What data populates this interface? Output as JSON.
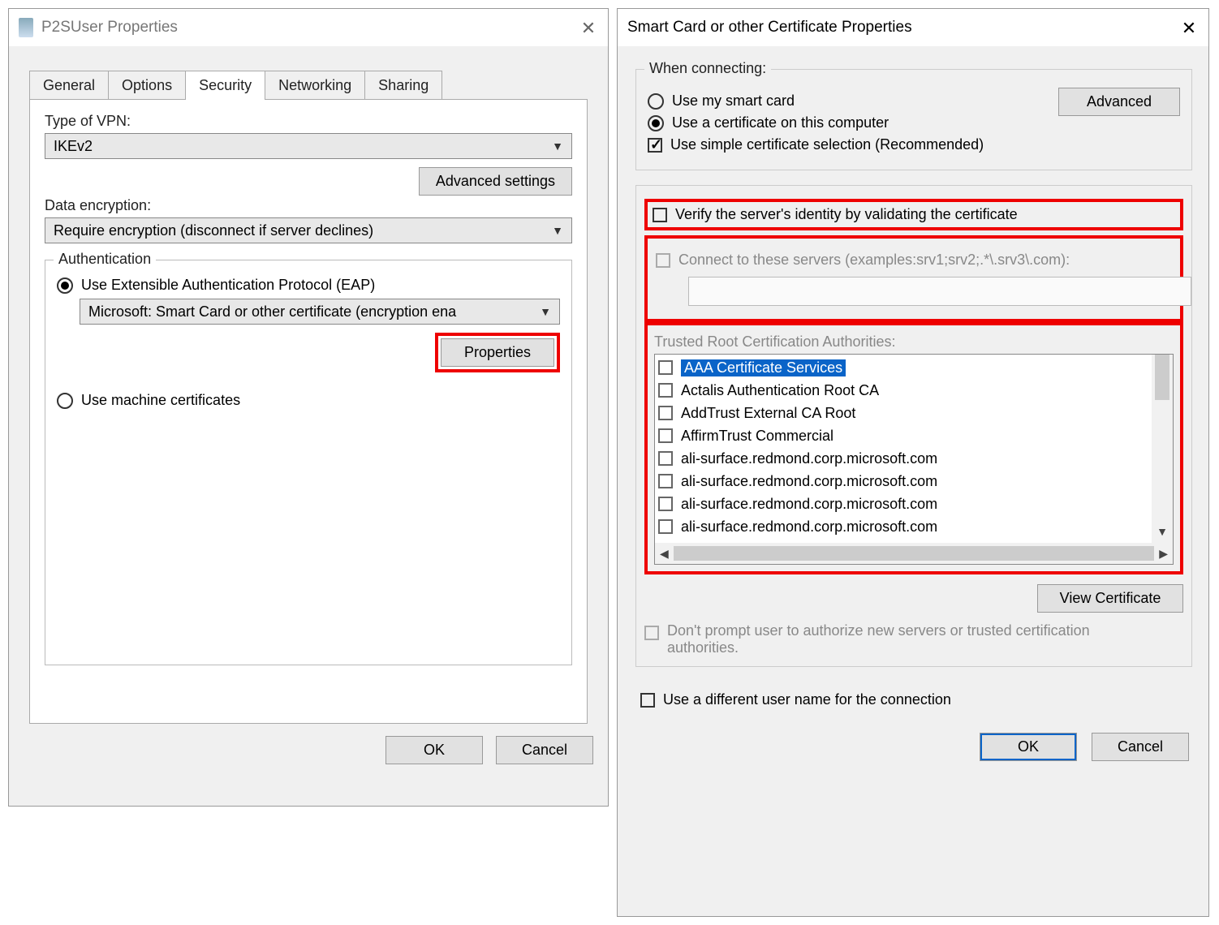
{
  "left": {
    "title": "P2SUser Properties",
    "tabs": [
      "General",
      "Options",
      "Security",
      "Networking",
      "Sharing"
    ],
    "active_tab_index": 2,
    "sec": {
      "vpn_label": "Type of VPN:",
      "vpn_value": "IKEv2",
      "advanced_settings": "Advanced settings",
      "enc_label": "Data encryption:",
      "enc_value": "Require encryption (disconnect if server declines)",
      "auth_legend": "Authentication",
      "radio_eap": "Use Extensible Authentication Protocol (EAP)",
      "eap_value": "Microsoft: Smart Card or other certificate (encryption ena",
      "properties_btn": "Properties",
      "radio_machine": "Use machine certificates"
    },
    "ok": "OK",
    "cancel": "Cancel"
  },
  "right": {
    "title": "Smart Card or other Certificate Properties",
    "connecting_legend": "When connecting:",
    "radio_smartcard": "Use my smart card",
    "radio_certcomputer": "Use a certificate on this computer",
    "advanced_btn": "Advanced",
    "chk_simple": "Use simple certificate selection (Recommended)",
    "chk_verify": "Verify the server's identity by validating the certificate",
    "chk_connect_servers": "Connect to these servers (examples:srv1;srv2;.*\\.srv3\\.com):",
    "trusted_label": "Trusted Root Certification Authorities:",
    "ca_items": [
      "AAA Certificate Services",
      "Actalis Authentication Root CA",
      "AddTrust External CA Root",
      "AffirmTrust Commercial",
      "ali-surface.redmond.corp.microsoft.com",
      "ali-surface.redmond.corp.microsoft.com",
      "ali-surface.redmond.corp.microsoft.com",
      "ali-surface.redmond.corp.microsoft.com"
    ],
    "view_cert": "View Certificate",
    "dont_prompt": "Don't prompt user to authorize new servers or trusted certification authorities.",
    "diff_user": "Use a different user name for the connection",
    "ok": "OK",
    "cancel": "Cancel"
  }
}
